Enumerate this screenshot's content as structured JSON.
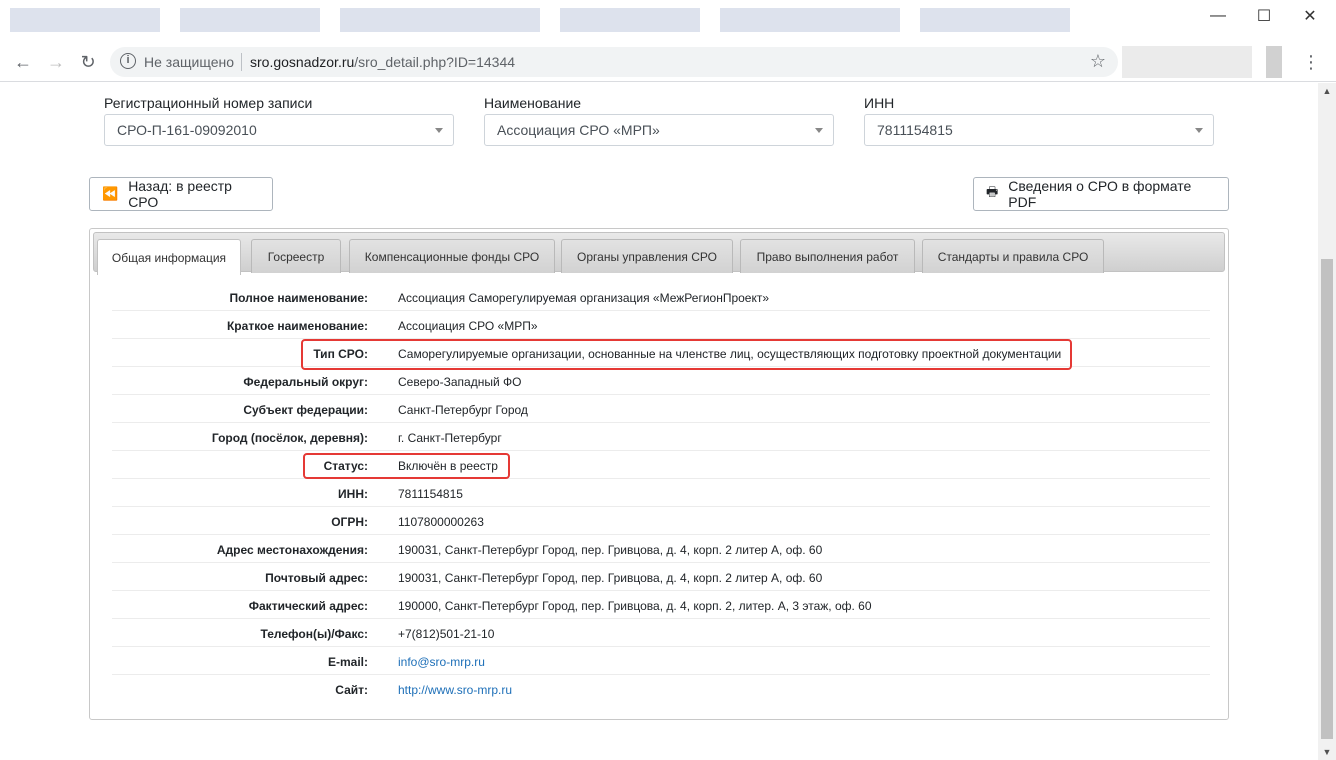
{
  "browser": {
    "security_label": "Не защищено",
    "url_host": "sro.gosnadzor.ru",
    "url_path": "/sro_detail.php?ID=14344",
    "window_controls": [
      "minimize-icon",
      "maximize-icon",
      "close-icon"
    ]
  },
  "filters": {
    "reg_number": {
      "label": "Регистрационный номер записи",
      "value": "СРО-П-161-09092010"
    },
    "name": {
      "label": "Наименование",
      "value": "Ассоциация СРО «МРП»"
    },
    "inn": {
      "label": "ИНН",
      "value": "7811154815"
    }
  },
  "actions": {
    "back_label": "Назад: в реестр СРО",
    "pdf_label": "Сведения о СРО в формате PDF"
  },
  "tabs": [
    {
      "label": "Общая информация",
      "active": true
    },
    {
      "label": "Госреестр",
      "active": false
    },
    {
      "label": "Компенсационные фонды СРО",
      "active": false
    },
    {
      "label": "Органы управления СРО",
      "active": false
    },
    {
      "label": "Право выполнения работ",
      "active": false
    },
    {
      "label": "Стандарты и правила СРО",
      "active": false
    }
  ],
  "details": [
    {
      "key": "Полное наименование:",
      "value": "Ассоциация Саморегулируемая организация «МежРегионПроект»"
    },
    {
      "key": "Краткое наименование:",
      "value": "Ассоциация СРО «МРП»"
    },
    {
      "key": "Тип СРО:",
      "value": "Саморегулируемые организации, основанные на членстве лиц, осуществляющих подготовку проектной документации"
    },
    {
      "key": "Федеральный округ:",
      "value": "Северо-Западный ФО"
    },
    {
      "key": "Субъект федерации:",
      "value": "Санкт-Петербург Город"
    },
    {
      "key": "Город (посёлок, деревня):",
      "value": "г. Санкт-Петербург"
    },
    {
      "key": "Статус:",
      "value": "Включён в реестр"
    },
    {
      "key": "ИНН:",
      "value": "7811154815"
    },
    {
      "key": "ОГРН:",
      "value": "1107800000263"
    },
    {
      "key": "Адрес местонахождения:",
      "value": "190031, Санкт-Петербург Город, пер. Гривцова, д. 4, корп. 2 литер А, оф. 60"
    },
    {
      "key": "Почтовый адрес:",
      "value": "190031, Санкт-Петербург Город, пер. Гривцова, д. 4, корп. 2 литер А, оф. 60"
    },
    {
      "key": "Фактический адрес:",
      "value": "190000, Санкт-Петербург Город, пер. Гривцова, д. 4, корп. 2, литер. А, 3 этаж, оф. 60"
    },
    {
      "key": "Телефон(ы)/Факс:",
      "value": "+7(812)501-21-10"
    },
    {
      "key": "E-mail:",
      "value": "info@sro-mrp.ru"
    },
    {
      "key": "Сайт:",
      "value": "http://www.sro-mrp.ru"
    }
  ],
  "colors": {
    "link": "#1d6fb8",
    "highlight": "#e53935"
  }
}
